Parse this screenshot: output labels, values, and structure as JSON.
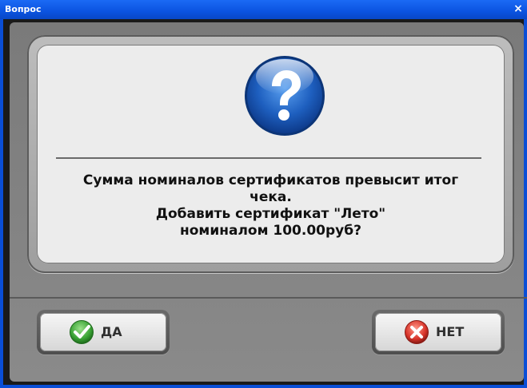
{
  "window": {
    "title": "Вопрос",
    "close_glyph": "×"
  },
  "dialog": {
    "icon": "question-icon",
    "message_lines": [
      "Сумма номиналов сертификатов превысит итог",
      "чека.",
      "Добавить сертификат \"Лето\"",
      "номиналом 100.00руб?"
    ]
  },
  "buttons": {
    "yes_label": "ДА",
    "yes_icon": "check-icon",
    "no_label": "НЕТ",
    "no_icon": "x-icon"
  },
  "colors": {
    "titlebar": "#0b53e0",
    "question_blue": "#1e5fbf",
    "yes_green": "#3aa235",
    "no_red": "#d8342a"
  }
}
